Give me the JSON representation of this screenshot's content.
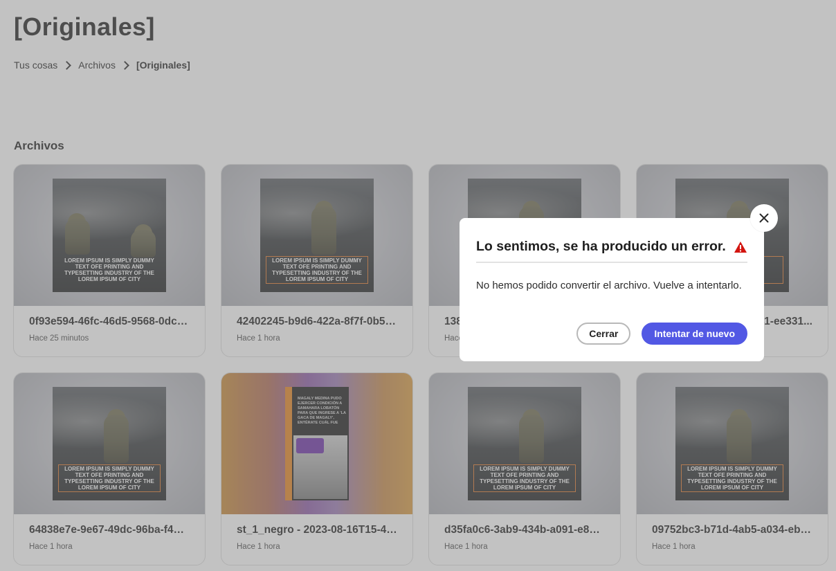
{
  "page": {
    "title": "[Originales]"
  },
  "breadcrumb": [
    "Tus cosas",
    "Archivos",
    "[Originales]"
  ],
  "section": {
    "title": "Archivos"
  },
  "cards": [
    {
      "name": "0f93e594-46fc-46d5-9568-0dca...",
      "time": "Hace 25 minutos",
      "thumb_text": "Lorem ipsum is simply dummy text ofe printing and typesetting industry of the lorem ipsum of city",
      "thumb_type": "soldiers"
    },
    {
      "name": "42402245-b9d6-422a-8f7f-0b59...",
      "time": "Hace 1 hora",
      "thumb_text": "Lorem ipsum is simply dummy text ofe printing and typesetting industry of the lorem ipsum of city",
      "thumb_type": "soldier"
    },
    {
      "name": "138",
      "time": "Hace",
      "thumb_text": "",
      "thumb_type": "soldier"
    },
    {
      "name": "41-ee331...",
      "time": "",
      "thumb_text": "",
      "thumb_type": "soldier"
    },
    {
      "name": "64838e7e-9e67-49dc-96ba-f477...",
      "time": "Hace 1 hora",
      "thumb_text": "Lorem ipsum is simply dummy text ofe printing and typesetting industry of the lorem ipsum of city",
      "thumb_type": "soldier"
    },
    {
      "name": "st_1_negro - 2023-08-16T15-45-34",
      "time": "Hace 1 hora",
      "thumb_text": "Magaly Medina pudo ejercer condición a Samahara Lobatón para que ingrese a 'La Gaca de Magaly', entérate cuál fue",
      "thumb_type": "story"
    },
    {
      "name": "d35fa0c6-3ab9-434b-a091-e857...",
      "time": "Hace 1 hora",
      "thumb_text": "Lorem ipsum is simply dummy text ofe printing and typesetting industry of the lorem ipsum of city",
      "thumb_type": "soldier"
    },
    {
      "name": "09752bc3-b71d-4ab5-a034-eb6...",
      "time": "Hace 1 hora",
      "thumb_text": "Lorem ipsum is simply dummy text ofe printing and typesetting industry of the lorem ipsum of city",
      "thumb_type": "soldier"
    }
  ],
  "dialog": {
    "title": "Lo sentimos, se ha producido un error.",
    "message": "No hemos podido convertir el archivo. Vuelve a intentarlo.",
    "secondary_label": "Cerrar",
    "primary_label": "Intentar de nuevo",
    "alert_icon": "alert-triangle-icon",
    "close_icon": "close-icon",
    "colors": {
      "primary": "#5258e4",
      "alert": "#d31510"
    }
  }
}
